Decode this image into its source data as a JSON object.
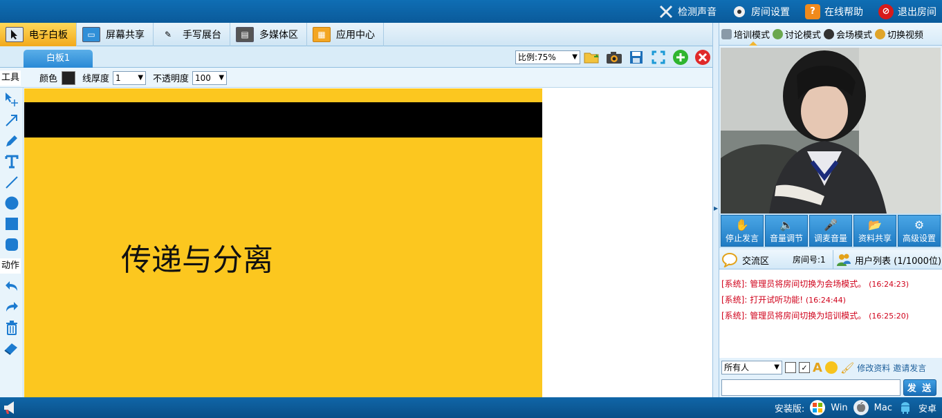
{
  "topbar": {
    "items": [
      {
        "label": "检测声音",
        "icon": "tools-icon"
      },
      {
        "label": "房间设置",
        "icon": "gear-icon"
      },
      {
        "label": "在线帮助",
        "icon": "help-icon"
      },
      {
        "label": "退出房间",
        "icon": "exit-icon"
      }
    ]
  },
  "main_tabs": [
    {
      "label": "电子白板",
      "icon": "cursor-icon",
      "active": true
    },
    {
      "label": "屏幕共享",
      "icon": "screen-share-icon"
    },
    {
      "label": "手写展台",
      "icon": "handwriting-icon"
    },
    {
      "label": "多媒体区",
      "icon": "film-icon"
    },
    {
      "label": "应用中心",
      "icon": "app-center-icon"
    }
  ],
  "whiteboard": {
    "tab_label": "白板1",
    "zoom_label": "比例:75%",
    "toolbar_icons": [
      "open-folder-icon",
      "camera-icon",
      "save-icon",
      "fullscreen-icon",
      "add-icon",
      "close-icon"
    ]
  },
  "props": {
    "tools_label": "工具",
    "color_label": "颜色",
    "line_width_label": "线厚度",
    "line_width_value": "1",
    "opacity_label": "不透明度",
    "opacity_value": "100"
  },
  "left_tools": [
    "move-select-icon",
    "arrow-icon",
    "pencil-icon",
    "text-icon",
    "line-icon",
    "circle-icon",
    "rectangle-icon",
    "rounded-rect-icon"
  ],
  "action_label": "动作",
  "actions": [
    "undo-icon",
    "redo-icon",
    "trash-icon",
    "eraser-icon"
  ],
  "slide": {
    "title": "传递与分离",
    "background": "#fcc71f",
    "band_color": "#000000"
  },
  "modes": [
    {
      "label": "培训模式",
      "active": true
    },
    {
      "label": "讨论模式"
    },
    {
      "label": "会场模式"
    },
    {
      "label": "切换视频"
    }
  ],
  "controls": [
    {
      "label": "停止发言",
      "icon": "hand-icon"
    },
    {
      "label": "音量调节",
      "icon": "volume-icon"
    },
    {
      "label": "调麦音量",
      "icon": "microphone-icon"
    },
    {
      "label": "资料共享",
      "icon": "folder-icon"
    },
    {
      "label": "高级设置",
      "icon": "gear-icon"
    }
  ],
  "chat": {
    "tab_label": "交流区",
    "room_label": "房间号:1",
    "users_label": "用户列表 (1/1000位)",
    "messages": [
      {
        "who": "[系统]:",
        "text": "管理员将房间切换为会场模式。",
        "time": "(16:24:23)"
      },
      {
        "who": "[系统]:",
        "text": "打开试听功能!",
        "time": "(16:24:44)"
      },
      {
        "who": "[系统]:",
        "text": "管理员将房间切换为培训模式。",
        "time": "(16:25:20)"
      }
    ],
    "recipient": "所有人",
    "edit_profile": "修改资料",
    "invite_speak": "邀请发言",
    "send_label": "发 送",
    "input_value": ""
  },
  "bottom": {
    "install_label": "安装版:",
    "platforms": [
      {
        "label": "Win",
        "icon": "windows-icon"
      },
      {
        "label": "Mac",
        "icon": "apple-icon"
      },
      {
        "label": "安卓",
        "icon": "android-icon"
      }
    ]
  },
  "colors": {
    "accent": "#0f6eb4",
    "active_tab": "#f2a91b",
    "system_msg": "#d0021b"
  }
}
